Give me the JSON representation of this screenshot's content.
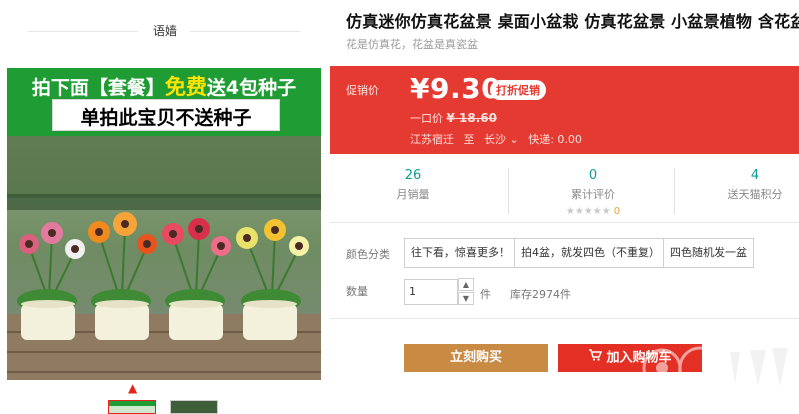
{
  "store": {
    "name": "语嫱"
  },
  "main_image": {
    "banner_line1_pre": "拍下面【套餐】",
    "banner_line1_free": "免费",
    "banner_line1_post": "送4包种子",
    "banner_line2": "单拍此宝贝不送种子"
  },
  "product": {
    "title": "仿真迷你仿真花盆景 桌面小盆栽 仿真花盆景 小盆景植物 含花盆",
    "subtitle": "花是仿真花，花盆是真瓷盆"
  },
  "promo": {
    "label": "促销价",
    "price": "¥9.30",
    "tag": "打折促销",
    "orig_label": "一口价",
    "orig_currency": "¥",
    "orig_value": "18.60",
    "origin": "江苏宿迁",
    "to": "至",
    "destination": "长沙",
    "express": "快递: 0.00"
  },
  "stats": {
    "monthly_sales": {
      "value": "26",
      "label": "月销量"
    },
    "reviews": {
      "value": "0",
      "label": "累计评价",
      "score": "0"
    },
    "points": {
      "value": "4",
      "label": "送天猫积分"
    }
  },
  "options": {
    "color_label": "颜色分类",
    "items": [
      "往下看，惊喜更多！",
      "拍4盆，就发四色（不重复）",
      "四色随机发一盆"
    ]
  },
  "quantity": {
    "label": "数量",
    "value": "1",
    "unit": "件",
    "stock": "库存2974件"
  },
  "actions": {
    "buy_label": "立刻购买",
    "cart_label": "加入购物车"
  },
  "colors": {
    "promo_bg": "#e43a31",
    "buy_bg": "#c98a44",
    "cart_bg": "#e42f25",
    "accent_teal": "#0f9a9a"
  }
}
